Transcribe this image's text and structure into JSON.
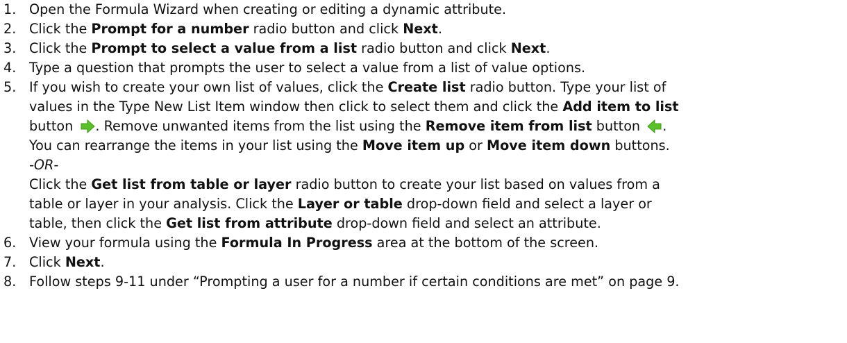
{
  "steps": [
    {
      "num": "1.",
      "text": "Open the Formula Wizard when creating or editing a dynamic attribute."
    },
    {
      "num": "2.",
      "t1": "Click the ",
      "b1": "Prompt for a number",
      "t2": " radio button and click ",
      "b2": "Next",
      "t3": "."
    },
    {
      "num": "3.",
      "t1": "Click the ",
      "b1": "Prompt to select a value from a list",
      "t2": " radio button and click ",
      "b2": "Next",
      "t3": "."
    },
    {
      "num": "4.",
      "text": "Type a question that prompts the user to select a value from a list of value options."
    },
    {
      "num": "5.",
      "l1_t1": "If you wish to create your own list of values, click the ",
      "l1_b1": "Create list",
      "l1_t2": " radio button.  Type your list of",
      "l2_t1": "values in the Type New List Item window then click to select them and click the ",
      "l2_b1": "Add item to list",
      "l3_t1": "button ",
      "l3_t2": ". Remove unwanted items from the list using the ",
      "l3_b1": "Remove item from list",
      "l3_t3": " button ",
      "l3_t4": ".",
      "l4_t1": "You can rearrange the items in your list using the ",
      "l4_b1": "Move item up",
      "l4_t2": " or ",
      "l4_b2": "Move item down",
      "l4_t3": " buttons.",
      "l5_i1": "-OR-",
      "l6_t1": "Click the ",
      "l6_b1": "Get list from table or layer",
      "l6_t2": " radio button to create your list based on values from a",
      "l7_t1": "table or layer in your analysis. Click the ",
      "l7_b1": "Layer or table",
      "l7_t2": " drop-down field and select a layer or",
      "l8_t1": "table, then click the ",
      "l8_b1": "Get list from attribute",
      "l8_t2": " drop-down field and select an attribute."
    },
    {
      "num": "6.",
      "t1": "View your formula using the ",
      "b1": "Formula In Progress",
      "t2": " area at the bottom of the screen."
    },
    {
      "num": "7.",
      "t1": "Click ",
      "b1": "Next",
      "t2": "."
    },
    {
      "num": "8.",
      "text": "Follow steps 9-11 under “Prompting a user for a number if certain conditions are met” on page 9."
    }
  ],
  "icons": {
    "add": {
      "name": "add-item-arrow-icon",
      "color": "#5cc02c"
    },
    "remove": {
      "name": "remove-item-arrow-icon",
      "color": "#5cc02c"
    }
  }
}
